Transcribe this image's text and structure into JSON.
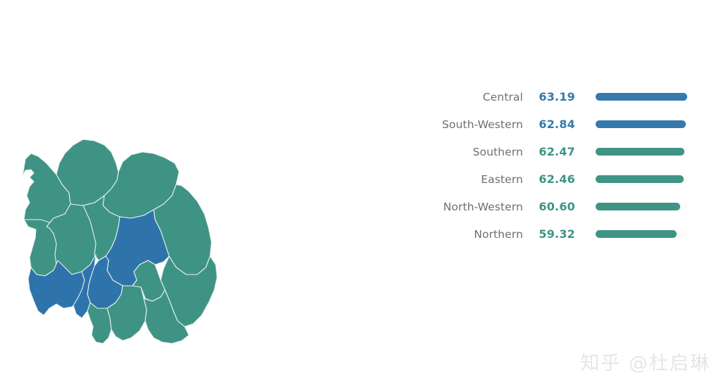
{
  "colors": {
    "map_green": "#3f9384",
    "map_blue": "#2e74ab",
    "map_border": "#e8f1ef",
    "bar_blue": "#3579ad",
    "bar_teal": "#3f9486",
    "bar_track": "#fbfbfa",
    "label_grey": "#6f6f6f",
    "background": "#ffffff",
    "watermark_grey": "#e6e6e6"
  },
  "watermark": {
    "text": "知乎 @杜启琳"
  },
  "map": {
    "name": "poland-voivodeships-map",
    "regions": [
      {
        "id": "zachodniopomorskie",
        "group": "North-Western",
        "color": "#3f9384"
      },
      {
        "id": "pomorskie",
        "group": "Northern",
        "color": "#3f9384"
      },
      {
        "id": "warminsko-mazurskie",
        "group": "Northern",
        "color": "#3f9384"
      },
      {
        "id": "podlaskie",
        "group": "Eastern",
        "color": "#3f9384"
      },
      {
        "id": "lubuskie",
        "group": "North-Western",
        "color": "#3f9384"
      },
      {
        "id": "wielkopolskie",
        "group": "North-Western",
        "color": "#3f9384"
      },
      {
        "id": "kujawsko-pomorskie",
        "group": "Northern",
        "color": "#3f9384"
      },
      {
        "id": "mazowieckie",
        "group": "Central",
        "color": "#2e74ab"
      },
      {
        "id": "lodzkie",
        "group": "Central",
        "color": "#2e74ab"
      },
      {
        "id": "lubelskie",
        "group": "Eastern",
        "color": "#3f9384"
      },
      {
        "id": "dolnoslaskie",
        "group": "South-Western",
        "color": "#2e74ab"
      },
      {
        "id": "opolskie",
        "group": "South-Western",
        "color": "#2e74ab"
      },
      {
        "id": "slaskie",
        "group": "Southern",
        "color": "#3f9384"
      },
      {
        "id": "malopolskie",
        "group": "Southern",
        "color": "#3f9384"
      },
      {
        "id": "swietokrzyskie",
        "group": "Eastern",
        "color": "#3f9384"
      },
      {
        "id": "podkarpackie",
        "group": "Eastern",
        "color": "#3f9384"
      }
    ]
  },
  "chart_data": {
    "type": "bar",
    "title": "",
    "xlabel": "",
    "ylabel": "",
    "orientation": "horizontal",
    "grid": false,
    "legend": false,
    "xlim": [
      0,
      63.19
    ],
    "categories": [
      "Central",
      "South-Western",
      "Southern",
      "Eastern",
      "North-Western",
      "Northern"
    ],
    "values": [
      63.19,
      62.84,
      62.47,
      62.46,
      60.6,
      59.32
    ],
    "value_labels": [
      "63.19",
      "62.84",
      "62.47",
      "62.46",
      "60.60",
      "59.32"
    ],
    "bar_colors": [
      "#3579ad",
      "#3579ad",
      "#3f9486",
      "#3f9486",
      "#3f9486",
      "#3f9486"
    ],
    "label_colors": [
      "#3579ad",
      "#3579ad",
      "#3f9486",
      "#3f9486",
      "#3f9486",
      "#3f9486"
    ],
    "rows": [
      {
        "label": "Central",
        "value": "63.19",
        "pct": 100.0,
        "bar_color": "#3579ad",
        "value_color": "#3579ad"
      },
      {
        "label": "South-Western",
        "value": "62.84",
        "pct": 98.4,
        "bar_color": "#3579ad",
        "value_color": "#3579ad"
      },
      {
        "label": "Southern",
        "value": "62.47",
        "pct": 96.6,
        "bar_color": "#3f9486",
        "value_color": "#3f9486"
      },
      {
        "label": "Eastern",
        "value": "62.46",
        "pct": 96.5,
        "bar_color": "#3f9486",
        "value_color": "#3f9486"
      },
      {
        "label": "North-Western",
        "value": "60.60",
        "pct": 92.0,
        "bar_color": "#3f9486",
        "value_color": "#3f9486"
      },
      {
        "label": "Northern",
        "value": "59.32",
        "pct": 88.5,
        "bar_color": "#3f9486",
        "value_color": "#3f9486"
      }
    ]
  }
}
